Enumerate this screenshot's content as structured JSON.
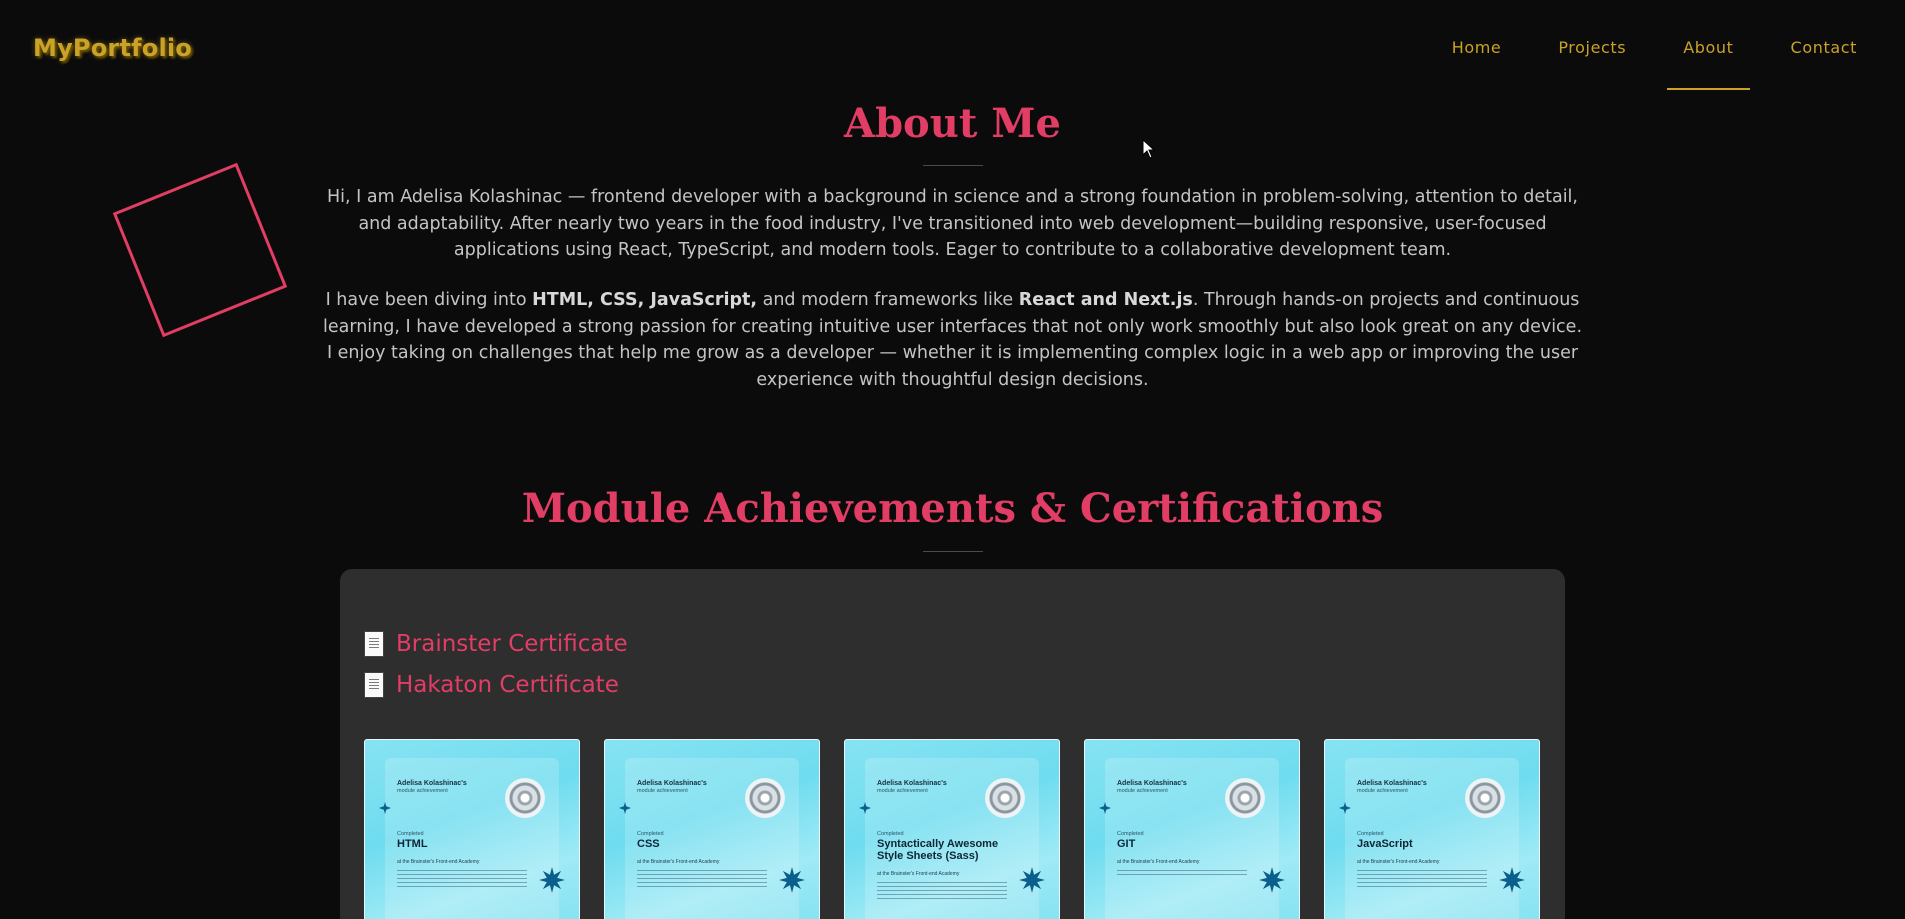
{
  "nav": {
    "logo": "MyPortfolio",
    "links": [
      "Home",
      "Projects",
      "About",
      "Contact"
    ],
    "active": "About"
  },
  "about": {
    "title": "About Me",
    "p1": "Hi, I am Adelisa Kolashinac — frontend developer with a background in science and a strong foundation in problem-solving, attention to detail, and adaptability. After nearly two years in the food industry, I've transitioned into web development—building responsive, user-focused applications using React, TypeScript, and modern tools. Eager to contribute to a collaborative development team.",
    "p2_a": "I have been diving into ",
    "p2_b": "HTML, CSS, JavaScript,",
    "p2_c": " and modern frameworks like ",
    "p2_d": "React and Next.js",
    "p2_e": ". Through hands-on projects and continuous learning, I have developed a strong passion for creating intuitive user interfaces that not only work smoothly but also look great on any device. I enjoy taking on challenges that help me grow as a developer — whether it is implementing complex logic in a web app or improving the user experience with thoughtful design decisions."
  },
  "achievements": {
    "title": "Module Achievements & Certifications",
    "links": [
      "Brainster Certificate",
      "Hakaton Certificate"
    ],
    "cards": [
      {
        "name": "Adelisa Kolashinac's",
        "sub": "module achievement",
        "completed": "Completed",
        "title": "HTML",
        "academy": "at the Brainster's Front-end Academy"
      },
      {
        "name": "Adelisa Kolashinac's",
        "sub": "module achievement",
        "completed": "Completed",
        "title": "CSS",
        "academy": "at the Brainster's Front-end Academy"
      },
      {
        "name": "Adelisa Kolashinac's",
        "sub": "module achievement",
        "completed": "Completed",
        "title": "Syntactically Awesome Style Sheets (Sass)",
        "academy": "at the Brainster's Front-end Academy"
      },
      {
        "name": "Adelisa Kolashinac's",
        "sub": "module achievement",
        "completed": "Completed",
        "title": "GIT",
        "academy": "at the Brainster's Front-end Academy"
      },
      {
        "name": "Adelisa Kolashinac's",
        "sub": "module achievement",
        "completed": "Completed",
        "title": "JavaScript",
        "academy": "at the Brainster's Front-end Academy"
      }
    ]
  },
  "colors": {
    "accent": "#e23d65",
    "nav": "#c9a227",
    "background": "#0b0b0c",
    "panel": "#2e2e2e"
  }
}
